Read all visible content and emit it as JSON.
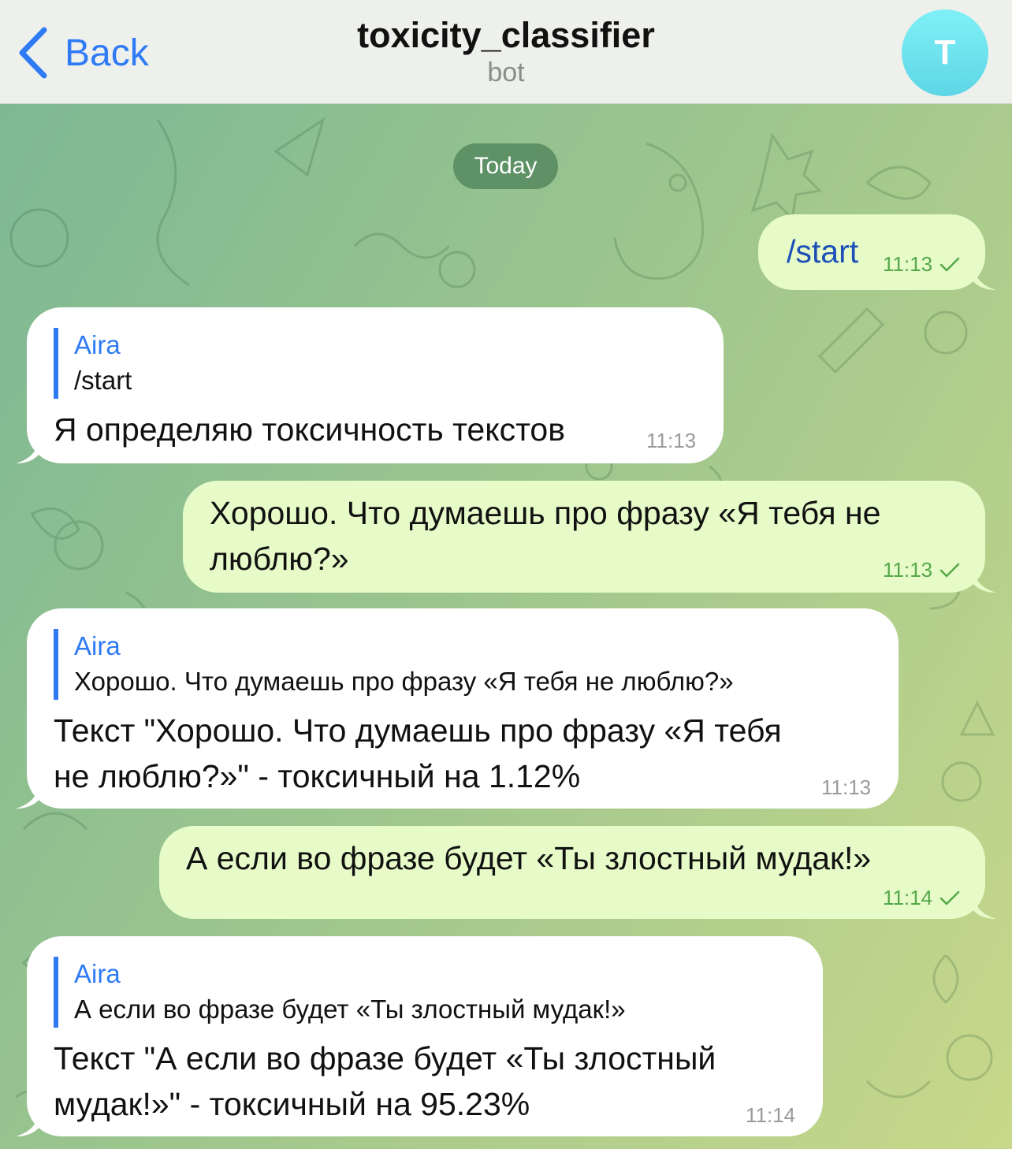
{
  "header": {
    "back_label": "Back",
    "title": "toxicity_classifier",
    "subtitle": "bot",
    "avatar_letter": "T",
    "accent_color": "#2f7bf5"
  },
  "chat": {
    "date_label": "Today",
    "messages": [
      {
        "direction": "outgoing",
        "text": "/start",
        "time": "11:13",
        "status": "sent-check-icon"
      },
      {
        "direction": "incoming",
        "reply_name": "Aira",
        "reply_text": "/start",
        "lines": [
          "Я определяю токсичность текстов"
        ],
        "time": "11:13"
      },
      {
        "direction": "outgoing",
        "lines": [
          "Хорошо. Что думаешь про фразу «Я тебя не",
          "люблю?»"
        ],
        "time": "11:13",
        "status": "sent-check-icon"
      },
      {
        "direction": "incoming",
        "reply_name": "Aira",
        "reply_text": "Хорошо. Что думаешь про фразу «Я тебя не люблю?»",
        "lines": [
          "Текст \"Хорошо. Что думаешь про фразу «Я тебя",
          "не люблю?»\" - токсичный на 1.12%"
        ],
        "time": "11:13"
      },
      {
        "direction": "outgoing",
        "lines": [
          "А если во фразе будет «Ты злостный мудак!»"
        ],
        "time": "11:14",
        "status": "sent-check-icon"
      },
      {
        "direction": "incoming",
        "reply_name": "Aira",
        "reply_text": "А если во фразе будет «Ты злостный мудак!»",
        "lines": [
          "Текст \"А если во фразе будет «Ты злостный",
          "мудак!»\" - токсичный на 95.23%"
        ],
        "time": "11:14"
      }
    ]
  },
  "colors": {
    "outgoing_bubble": "#e6fbc8",
    "incoming_bubble": "#ffffff",
    "outgoing_time": "#55a84a",
    "incoming_time": "#9a9a9a",
    "avatar": "#6ee2ee"
  }
}
